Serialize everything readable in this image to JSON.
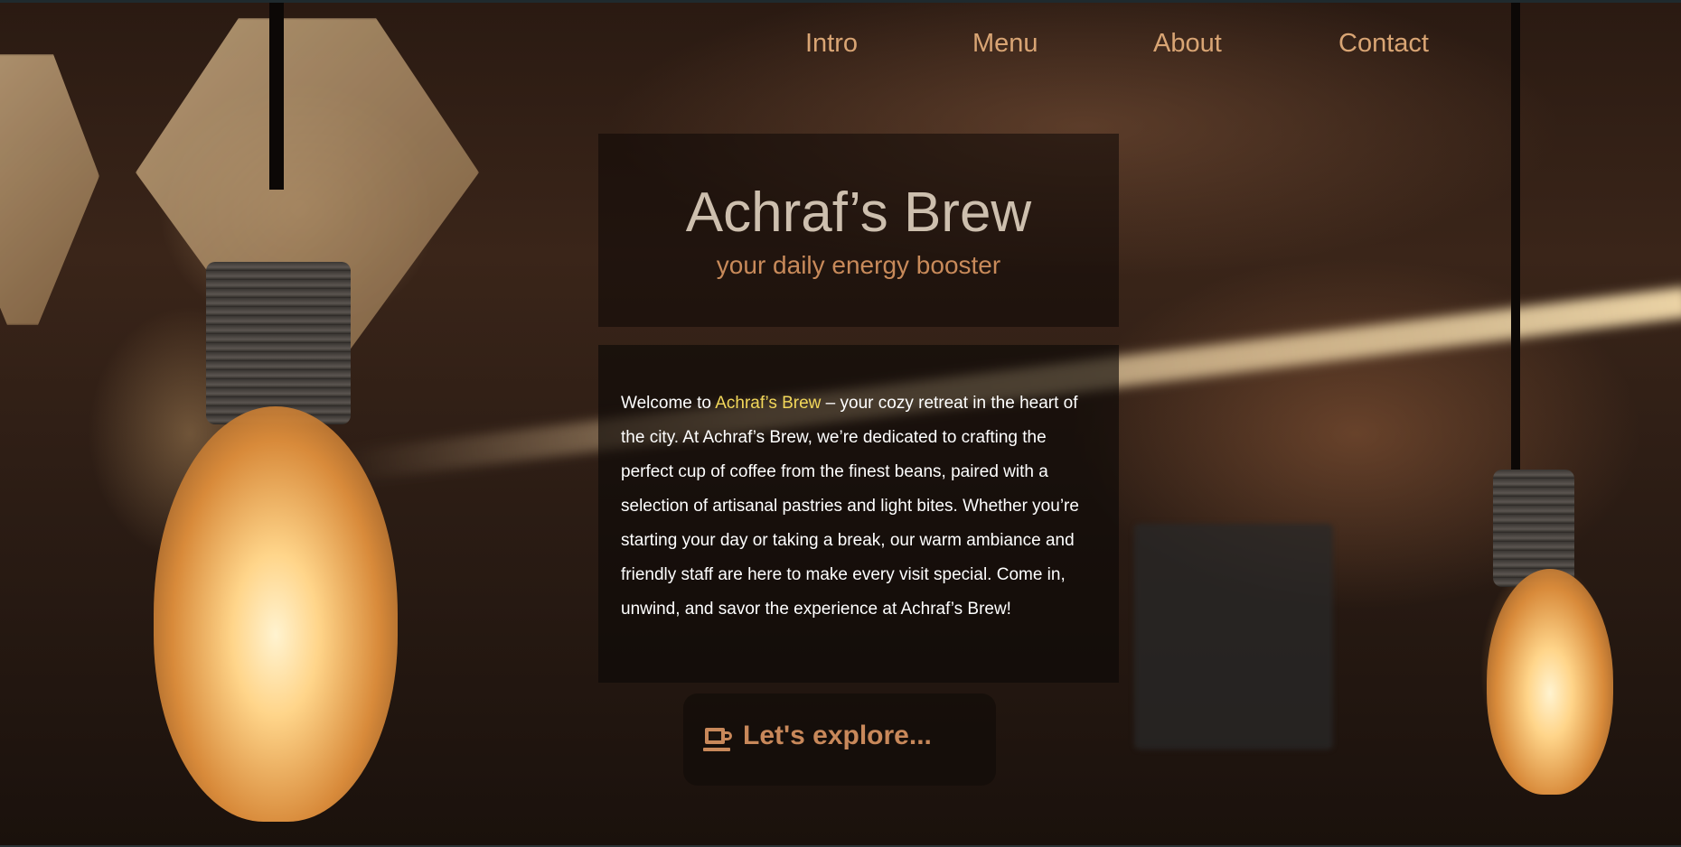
{
  "nav": {
    "items": [
      "Intro",
      "Menu",
      "About",
      "Contact"
    ]
  },
  "hero": {
    "title": "Achraf’s Brew",
    "subtitle": "your daily energy booster"
  },
  "welcome": {
    "prefix": "Welcome to ",
    "highlight": "Achraf’s Brew",
    "body": " – your cozy retreat in the heart of the city. At Achraf’s Brew, we’re dedicated to crafting the perfect cup of coffee from the finest beans, paired with a selection of artisanal pastries and light bites. Whether you’re starting your day or taking a break, our warm ambiance and friendly staff are here to make every visit special. Come in, unwind, and savor the experience at Achraf’s Brew!"
  },
  "cta": {
    "icon": "coffee-cup-icon",
    "label": "Let's explore..."
  },
  "colors": {
    "nav_link": "#d9a574",
    "title": "#cdbfae",
    "subtitle": "#c88a5a",
    "highlight": "#f2d75a",
    "cta_text": "#c8885a"
  }
}
